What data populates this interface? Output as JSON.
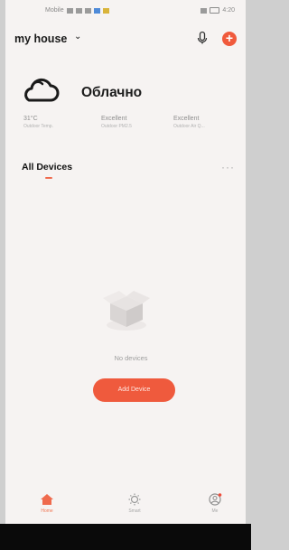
{
  "status_bar": {
    "left": "Mobile",
    "right": "4:20"
  },
  "header": {
    "home_name": "my house",
    "chevron": "⌄"
  },
  "weather": {
    "condition": "Облачно",
    "icon": "cloud-icon",
    "stats": [
      {
        "value": "31°C",
        "label": "Outdoor Temp."
      },
      {
        "value": "Excellent",
        "label": "Outdoor PM2.5"
      },
      {
        "value": "Excellent",
        "label": "Outdoor Air Q..."
      }
    ]
  },
  "devices": {
    "title": "All Devices",
    "more": "···",
    "empty_text": "No devices",
    "add_button": "Add Device"
  },
  "tabbar": {
    "items": [
      {
        "label": "Home",
        "icon": "home-icon",
        "active": true
      },
      {
        "label": "Smart",
        "icon": "smart-icon",
        "active": false
      },
      {
        "label": "Me",
        "icon": "profile-icon",
        "active": false
      }
    ]
  },
  "colors": {
    "accent": "#ef5a3d",
    "background": "#f6f3f2"
  }
}
